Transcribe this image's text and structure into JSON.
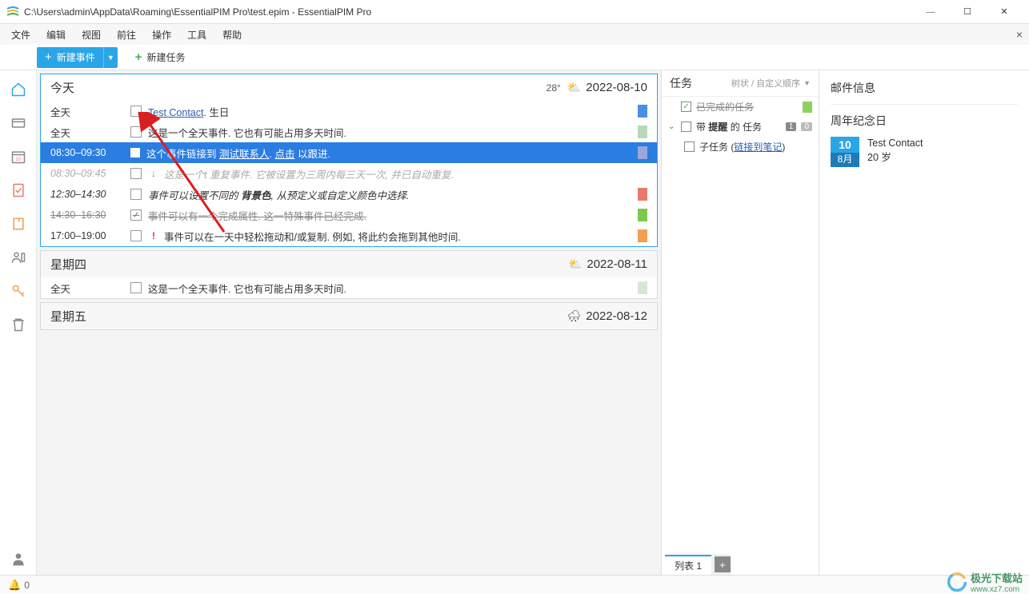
{
  "window": {
    "title": "C:\\Users\\admin\\AppData\\Roaming\\EssentialPIM Pro\\test.epim - EssentialPIM Pro"
  },
  "menu": {
    "items": [
      "文件",
      "编辑",
      "视图",
      "前往",
      "操作",
      "工具",
      "帮助"
    ]
  },
  "toolbar": {
    "new_event": "新建事件",
    "new_task": "新建任务"
  },
  "agenda": {
    "days": [
      {
        "title": "今天",
        "weather_text": "28°",
        "weather_icon": "⛅",
        "date": "2022-08-10",
        "today": true
      },
      {
        "title": "星期四",
        "weather_text": "",
        "weather_icon": "⛅",
        "date": "2022-08-11",
        "today": false
      },
      {
        "title": "星期五",
        "weather_text": "",
        "weather_icon": "🌧",
        "date": "2022-08-12",
        "today": false
      }
    ],
    "today_events": {
      "r1_time": "全天",
      "r1_link": "Test Contact",
      "r1_suffix": ". 生日",
      "r1_tag": "#4a90e2",
      "r2_time": "全天",
      "r2_text": "这是一个全天事件. 它也有可能占用多天时间.",
      "r2_tag": "#b8d8b8",
      "r3_time": "08:30–09:30",
      "r3_prefix": "这个事件链接到 ",
      "r3_link": "测试联系人",
      "r3_mid": ". ",
      "r3_link2": "点击",
      "r3_suffix": " 以跟进.",
      "r3_tag": "#9aa7d8",
      "r4_time": "08:30–09:45",
      "r4_icon": "↓",
      "r4_text": "这是一个t 重复事件. 它被设置为三周内每三天一次, 并已自动重复.",
      "r5_time": "12:30–14:30",
      "r5_text_pre": "事件可以设置不同的 ",
      "r5_text_b": "背景色",
      "r5_text_post": ", 从预定义或自定义颜色中选择.",
      "r5_tag": "#e87a6a",
      "r6_time": "14:30–16:30",
      "r6_text": "事件可以有一个完成属性. 这一特殊事件已经完成.",
      "r6_tag": "#7ec850",
      "r7_time": "17:00–19:00",
      "r7_icon": "!",
      "r7_text": "事件可以在一天中轻松拖动和/或复制. 例如, 将此约会拖到其他时间.",
      "r7_tag": "#f0a050"
    },
    "thursday_events": {
      "r1_time": "全天",
      "r1_text": "这是一个全天事件. 它也有可能占用多天时间.",
      "r1_tag": "#d8e8d0"
    }
  },
  "tasks": {
    "header": "任务",
    "sort": "树状 / 自定义顺序",
    "t1": "已完成的任务",
    "t1_tag": "#8fd060",
    "t2_pre": "带 ",
    "t2_b": "提醒",
    "t2_post": " 的 任务",
    "t2_c1": "1",
    "t2_c2": "0",
    "t3_pre": "子任务 (",
    "t3_link": "链接到笔记",
    "t3_post": ")"
  },
  "info": {
    "mail_header": "邮件信息",
    "anniv_header": "周年纪念日",
    "anniv_day": "10",
    "anniv_month": "8月",
    "anniv_name": "Test Contact",
    "anniv_age": "20 岁"
  },
  "bottom": {
    "tab1": "列表 1"
  },
  "status": {
    "count": "0"
  },
  "watermark": {
    "text1": "极光下载站",
    "text2": "www.xz7.com"
  }
}
